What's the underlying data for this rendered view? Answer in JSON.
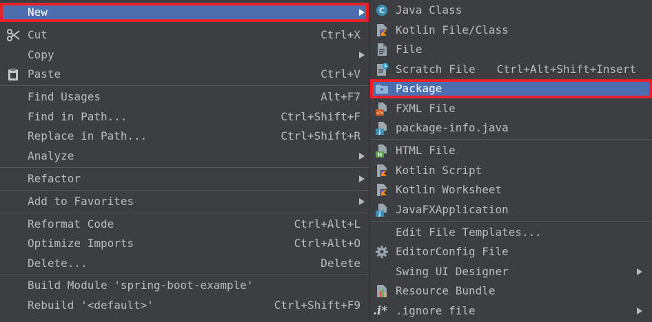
{
  "main_menu": {
    "items": [
      {
        "label": "New",
        "shortcut": "",
        "submenu": true
      },
      {
        "label": "Cut",
        "shortcut": "Ctrl+X",
        "submenu": false
      },
      {
        "label": "Copy",
        "shortcut": "",
        "submenu": true
      },
      {
        "label": "Paste",
        "shortcut": "Ctrl+V",
        "submenu": false
      },
      {
        "label": "Find Usages",
        "shortcut": "Alt+F7",
        "submenu": false
      },
      {
        "label": "Find in Path...",
        "shortcut": "Ctrl+Shift+F",
        "submenu": false
      },
      {
        "label": "Replace in Path...",
        "shortcut": "Ctrl+Shift+R",
        "submenu": false
      },
      {
        "label": "Analyze",
        "shortcut": "",
        "submenu": true
      },
      {
        "label": "Refactor",
        "shortcut": "",
        "submenu": true
      },
      {
        "label": "Add to Favorites",
        "shortcut": "",
        "submenu": true
      },
      {
        "label": "Reformat Code",
        "shortcut": "Ctrl+Alt+L",
        "submenu": false
      },
      {
        "label": "Optimize Imports",
        "shortcut": "Ctrl+Alt+O",
        "submenu": false
      },
      {
        "label": "Delete...",
        "shortcut": "Delete",
        "submenu": false
      },
      {
        "label": "Build Module 'spring-boot-example'",
        "shortcut": "",
        "submenu": false
      },
      {
        "label": "Rebuild '<default>'",
        "shortcut": "Ctrl+Shift+F9",
        "submenu": false
      }
    ]
  },
  "new_submenu": {
    "items": [
      {
        "label": "Java Class",
        "shortcut": "",
        "submenu": false,
        "icon": "java-class-icon"
      },
      {
        "label": "Kotlin File/Class",
        "shortcut": "",
        "submenu": false,
        "icon": "kotlin-file-icon"
      },
      {
        "label": "File",
        "shortcut": "",
        "submenu": false,
        "icon": "file-icon"
      },
      {
        "label": "Scratch File",
        "shortcut": "Ctrl+Alt+Shift+Insert",
        "submenu": false,
        "icon": "scratch-file-icon"
      },
      {
        "label": "Package",
        "shortcut": "",
        "submenu": false,
        "icon": "package-folder-icon"
      },
      {
        "label": "FXML File",
        "shortcut": "",
        "submenu": false,
        "icon": "fxml-file-icon"
      },
      {
        "label": "package-info.java",
        "shortcut": "",
        "submenu": false,
        "icon": "java-file-icon"
      },
      {
        "label": "HTML File",
        "shortcut": "",
        "submenu": false,
        "icon": "html-file-icon"
      },
      {
        "label": "Kotlin Script",
        "shortcut": "",
        "submenu": false,
        "icon": "kotlin-script-icon"
      },
      {
        "label": "Kotlin Worksheet",
        "shortcut": "",
        "submenu": false,
        "icon": "kotlin-worksheet-icon"
      },
      {
        "label": "JavaFXApplication",
        "shortcut": "",
        "submenu": false,
        "icon": "javafx-application-icon"
      },
      {
        "label": "Edit File Templates...",
        "shortcut": "",
        "submenu": false,
        "icon": ""
      },
      {
        "label": "EditorConfig File",
        "shortcut": "",
        "submenu": false,
        "icon": "gear-icon"
      },
      {
        "label": "Swing UI Designer",
        "shortcut": "",
        "submenu": true,
        "icon": ""
      },
      {
        "label": "Resource Bundle",
        "shortcut": "",
        "submenu": false,
        "icon": "resource-bundle-icon"
      },
      {
        "label": ".ignore file",
        "shortcut": "",
        "submenu": true,
        "icon": "ignore-file-icon",
        "glyph": ".i*"
      }
    ]
  },
  "colors": {
    "menu_background": "#3c3f41",
    "selection": "#4b6eaf",
    "highlight_outline": "#e8212b",
    "separator": "#515658",
    "text": "#bbbbbb"
  }
}
